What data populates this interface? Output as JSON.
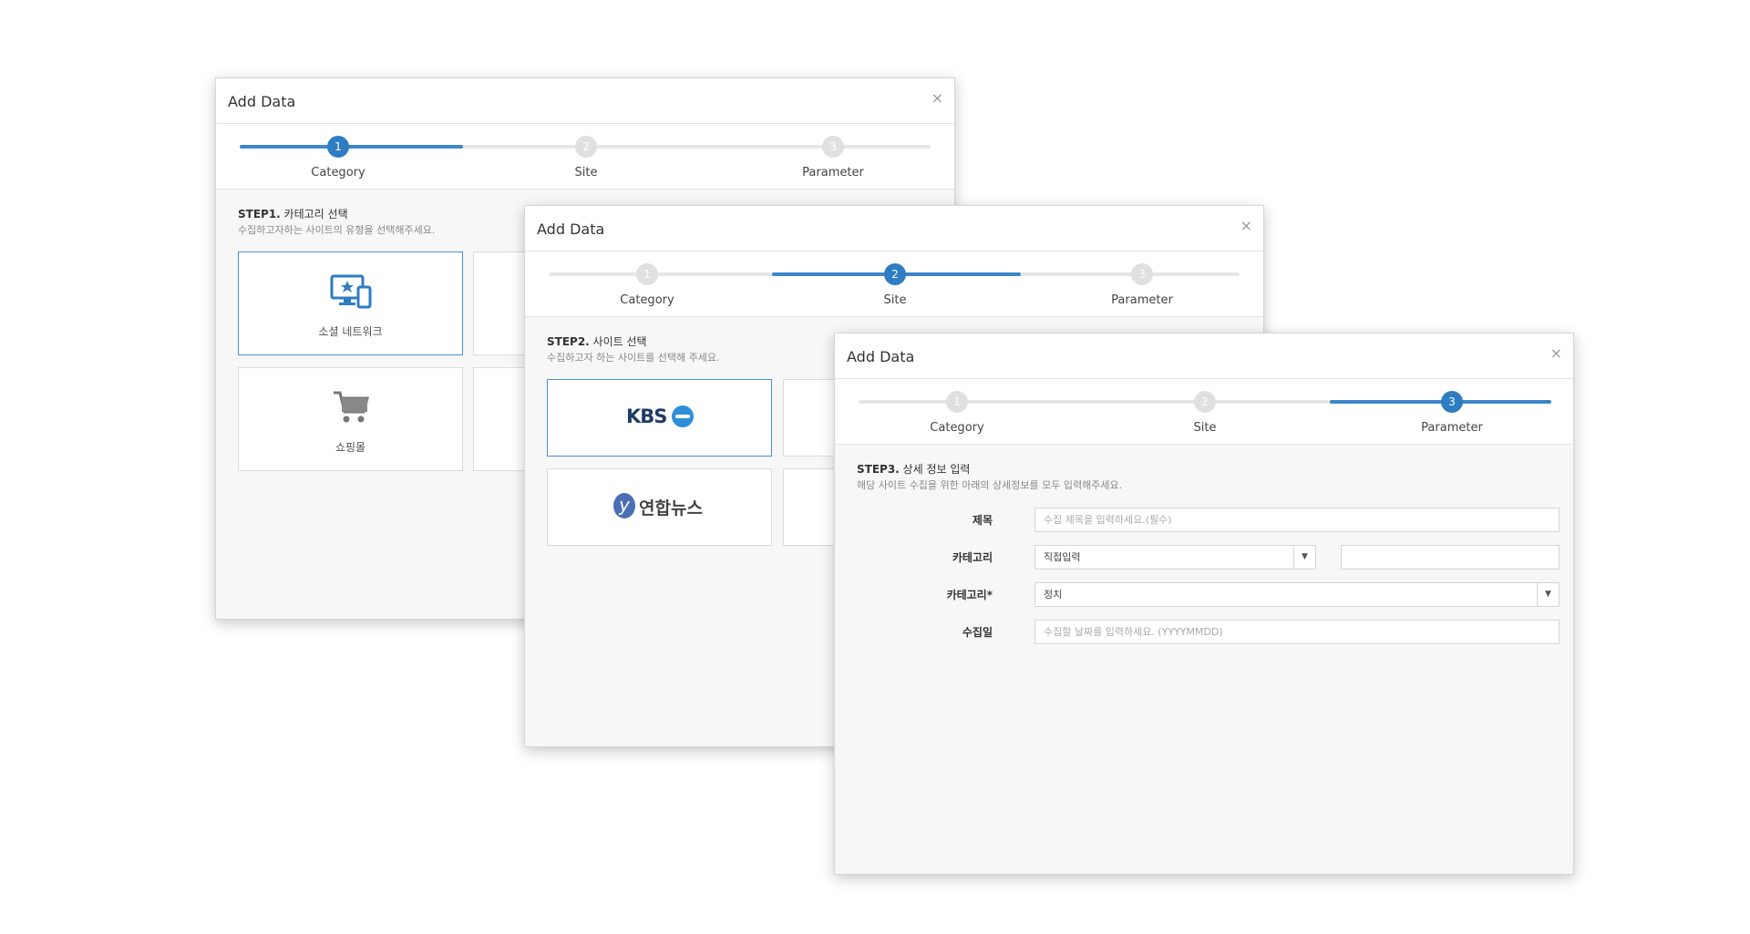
{
  "dialog": {
    "title": "Add Data",
    "close": "×"
  },
  "steps": [
    {
      "num": "1",
      "label": "Category"
    },
    {
      "num": "2",
      "label": "Site"
    },
    {
      "num": "3",
      "label": "Parameter"
    }
  ],
  "step1": {
    "title_prefix": "STEP1.",
    "title_text": " 카테고리 선택",
    "desc": "수집하고자하는 사이트의 유형을 선택해주세요.",
    "cards": [
      {
        "label": "소셜 네트워크",
        "icon": "social-network-icon"
      },
      {
        "label": "쇼핑몰",
        "icon": "shopping-cart-icon"
      }
    ]
  },
  "step2": {
    "title_prefix": "STEP2.",
    "title_text": " 사이트 선택",
    "desc": "수집하고자 하는 사이트를 선택해 주세요.",
    "sites": [
      {
        "logo_text": "KBS",
        "icon": "kbs-logo-icon"
      },
      {
        "logo_mark": "y",
        "logo_text": "연합뉴스",
        "icon": "yonhap-news-logo-icon"
      }
    ]
  },
  "step3": {
    "title_prefix": "STEP3.",
    "title_text": " 상세 정보 입력",
    "desc": "해당 사이트 수집을 위한 아래의 상세정보를 모두 입력해주세요.",
    "fields": {
      "title": {
        "label": "제목",
        "placeholder": "수집 제목을 입력하세요.(필수)"
      },
      "category_mode": {
        "label": "카테고리",
        "value": "직접입력",
        "extra_value": ""
      },
      "category": {
        "label": "카테고리*",
        "value": "정치"
      },
      "date": {
        "label": "수집일",
        "placeholder": "수집할 날짜를 입력하세요. (YYYYMMDD)"
      }
    },
    "caret": "▼"
  },
  "colors": {
    "accent": "#2e7cc2",
    "inactive": "#e0e0e0"
  }
}
